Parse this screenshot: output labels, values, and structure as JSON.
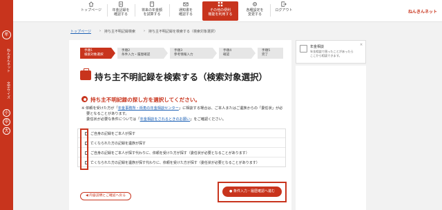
{
  "brand": "ねんきんネット",
  "nav": [
    {
      "label_line1": "トップページ",
      "label_line2": ""
    },
    {
      "label_line1": "年金記録を",
      "label_line2": "確認する"
    },
    {
      "label_line1": "将来の年金額",
      "label_line2": "を試算する"
    },
    {
      "label_line1": "通知書を",
      "label_line2": "確認する"
    },
    {
      "label_line1": "その他の便利",
      "label_line2": "機能を利用する"
    },
    {
      "label_line1": "各種設定を",
      "label_line2": "変更する"
    },
    {
      "label_line1": "ログアウト",
      "label_line2": ""
    }
  ],
  "breadcrumb": {
    "home": "トップページ",
    "middle": "持ち主不明記録検索",
    "current": "持ち主不明記録を検索する（検索対象選択）"
  },
  "steps": [
    {
      "no": "手順1",
      "label": "検索対象選択"
    },
    {
      "no": "手順2",
      "label": "条件入力・履歴確認"
    },
    {
      "no": "手順3",
      "label": "参考情報入力"
    },
    {
      "no": "手順4",
      "label": "確認"
    },
    {
      "no": "手順5",
      "label": "完了"
    }
  ],
  "page_title": "持ち主不明記録を検索する（検索対象選択）",
  "section_heading": "持ち主不明記録の探し方を選択してください。",
  "notes": {
    "line1_pre": "※ 依頼を受けた方が「",
    "line1_link": "年金事務所・街角の年金相談センター",
    "line1_post": "」に相談する場合は、ご本人またはご遺族からの「委任状」が必",
    "line2": "要となることがあります。",
    "line3_pre": "委任状が必要な条件については「",
    "line3_link": "年金相談をされるときのお願い",
    "line3_post": "」をご確認ください。"
  },
  "options": [
    "ご自身の記録をご本人が探す",
    "亡くなられた方の記録を遺族が探す",
    "ご自身の記録をご本人が探す代わりに、依頼を受けた方が探す（委任状が必要となることがあります）",
    "亡くなられた方の記録を遺族が探す代わりに、依頼を受けた方が探す（委任状が必要となることがあります）"
  ],
  "buttons": {
    "back": "内容説明とご確認へ戻る",
    "next": "条件入力・履歴確認へ進む"
  },
  "side_panel": {
    "title": "年金相談",
    "text1": "年金相談で困ったことがあったら",
    "text2": "ここから相談できます。",
    "close": "×"
  },
  "rail": {
    "logo": "年",
    "menu_text": "ねんきんネット",
    "vertical_text": "文字サイズ",
    "btn_small": "小",
    "btn_mid": "中",
    "btn_large": "大"
  },
  "colors": {
    "accent": "#c8341d",
    "link": "#1a5fb4"
  }
}
